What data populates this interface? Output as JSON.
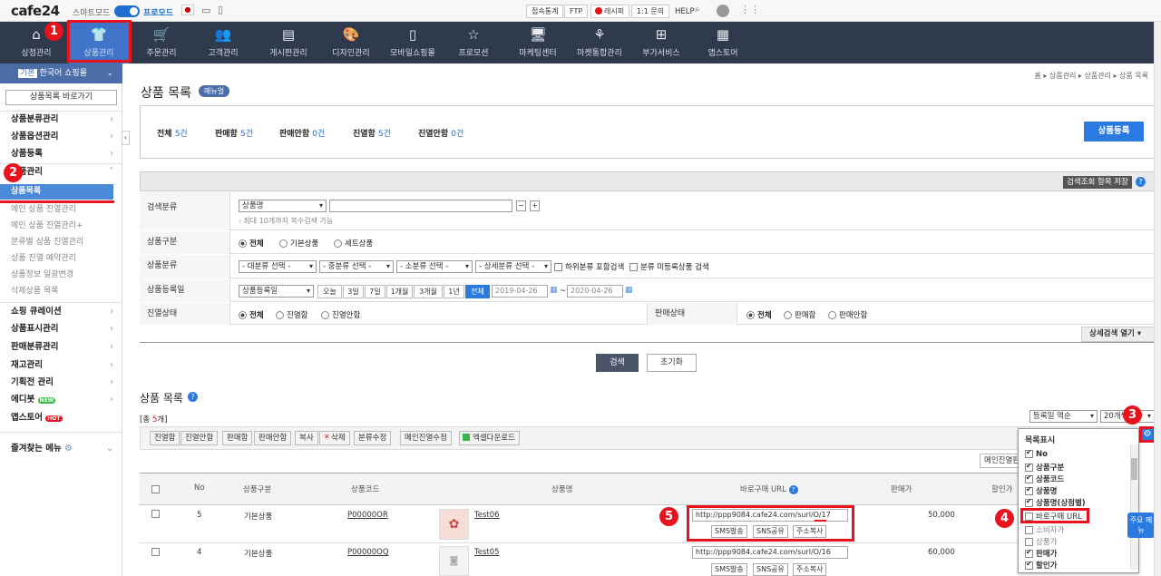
{
  "topbar": {
    "logo": "cafe24",
    "smart_mode": "스마트모드",
    "pro_mode": "프로모드",
    "buttons": [
      "접속통계",
      "FTP",
      "레시피",
      "1:1 문의"
    ],
    "help": "HELP"
  },
  "nav": [
    {
      "label": "상점관리",
      "icon": "⌂"
    },
    {
      "label": "상품관리",
      "icon": "👕"
    },
    {
      "label": "주문관리",
      "icon": "🛒"
    },
    {
      "label": "고객관리",
      "icon": "👥"
    },
    {
      "label": "게시판관리",
      "icon": "▤"
    },
    {
      "label": "디자인관리",
      "icon": "🎨"
    },
    {
      "label": "모바일쇼핑몰",
      "icon": "▯"
    },
    {
      "label": "프로모션",
      "icon": "☆"
    },
    {
      "label": "마케팅센터",
      "icon": "🖥"
    },
    {
      "label": "마켓통합관리",
      "icon": "⚘"
    },
    {
      "label": "부가서비스",
      "icon": "⊞"
    },
    {
      "label": "앱스토어",
      "icon": "▦"
    }
  ],
  "badges": [
    "1",
    "2",
    "3",
    "4",
    "5"
  ],
  "sidebar": {
    "store_tag": "기본",
    "store": "한국어 쇼핑몰",
    "goto": "상품목록 바로가기",
    "groups1": [
      "상품분류관리",
      "상품옵션관리",
      "상품등록"
    ],
    "open_group": "상품관리",
    "active": "상품목록",
    "subs": [
      "메인 상품 진열관리",
      "메인 상품 진열관리+",
      "분류별 상품 진열관리",
      "상품 진열 예약관리",
      "상품정보 일괄변경",
      "삭제상품 목록"
    ],
    "groups2": [
      "쇼핑 큐레이션",
      "상품표시관리",
      "판매분류관리",
      "재고관리",
      "기획전 관리",
      "에디봇",
      "앱스토어"
    ],
    "new_badge": "NEW",
    "hot_badge": "HOT",
    "favorites": "즐겨찾는 메뉴"
  },
  "breadcrumb": "홈 ▸ 상품관리 ▸ 상품관리 ▸ 상품 목록",
  "title": "상품 목록",
  "manual": "매뉴얼",
  "summary": [
    {
      "label": "전체",
      "count": "5건"
    },
    {
      "label": "판매함",
      "count": "5건"
    },
    {
      "label": "판매안함",
      "count": "0건"
    },
    {
      "label": "진열함",
      "count": "5건"
    },
    {
      "label": "진열안함",
      "count": "0건"
    }
  ],
  "register": "상품등록",
  "save_search": "검색조회 항목 저장",
  "search": {
    "cls_label": "검색분류",
    "cls_select": "상품명",
    "cls_hint": "- 최대 10개까지 복수검색 가능",
    "type_label": "상품구분",
    "type_opts": [
      "전체",
      "기본상품",
      "세트상품"
    ],
    "cat_label": "상품분류",
    "cat_selects": [
      "- 대분류 선택 -",
      "- 중분류 선택 -",
      "- 소분류 선택 -",
      "- 상세분류 선택 -"
    ],
    "cat_chk1": "하위분류 포함검색",
    "cat_chk2": "분류 미등록상품 검색",
    "date_label": "상품등록일",
    "date_select": "상품등록일",
    "date_btns": [
      "오늘",
      "3일",
      "7일",
      "1개월",
      "3개월",
      "1년",
      "전체"
    ],
    "date_from": "2019-04-26",
    "date_to": "2020-04-26",
    "disp_label": "진열상태",
    "disp_opts": [
      "전체",
      "진열함",
      "진열안함"
    ],
    "sale_label": "판매상태",
    "sale_opts": [
      "전체",
      "판매함",
      "판매안함"
    ],
    "detail": "상세검색 열기",
    "search_btn": "검색",
    "reset_btn": "초기화"
  },
  "list": {
    "title": "상품 목록",
    "total_prefix": "[총 ",
    "total": "5",
    "total_suffix": "개]",
    "sort": "등록일 역순",
    "perpage": "20개씩",
    "toolbar": [
      "진열함",
      "진열안함",
      "판매함",
      "판매안함",
      "복사",
      "삭제",
      "분류수정",
      "메인진열수정",
      "엑셀다운로드"
    ],
    "main_disp": "메인진열판",
    "headers": [
      "No",
      "상품구분",
      "상품코드",
      "상품명",
      "바로구매 URL",
      "판매가",
      "할인가"
    ],
    "rows": [
      {
        "no": "5",
        "type": "기본상품",
        "code": "P00000OR",
        "name": "Test06",
        "url": "http://ppp9084.cafe24.com/surl/O/17",
        "price": "50,000"
      },
      {
        "no": "4",
        "type": "기본상품",
        "code": "P00000OQ",
        "name": "Test05",
        "url": "http://ppp9084.cafe24.com/surl/O/16",
        "price": "60,000"
      }
    ],
    "row_btns": [
      "SMS발송",
      "SNS공유",
      "주소복사"
    ]
  },
  "popup": {
    "title": "목록표시",
    "items": [
      {
        "label": "No",
        "on": true
      },
      {
        "label": "상품구분",
        "on": true
      },
      {
        "label": "상품코드",
        "on": true
      },
      {
        "label": "상품명",
        "on": true
      },
      {
        "label": "상품명(상점별)",
        "on": true
      },
      {
        "label": "바로구매 URL",
        "on": false
      },
      {
        "label": "소비자가",
        "on": false
      },
      {
        "label": "상품가",
        "on": false
      },
      {
        "label": "판매가",
        "on": true
      },
      {
        "label": "할인가",
        "on": true
      }
    ]
  },
  "quick_menu": "주요 메뉴",
  "colors": {
    "nav": "#2f3a4d",
    "accent": "#3f74c8",
    "highlight": "#e8131c"
  }
}
